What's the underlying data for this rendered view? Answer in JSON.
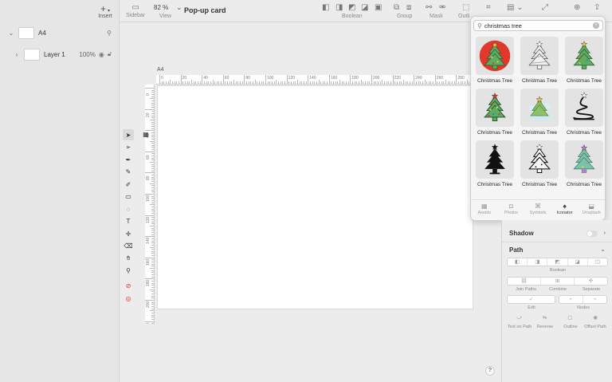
{
  "toolbar": {
    "insert_label": "Insert",
    "sidebar_label": "Sidebar",
    "view_label": "View",
    "zoom_value": "82 %",
    "document_title": "Pop-up card",
    "boolean_label": "Boolean",
    "group_label": "Group",
    "mask_label": "Mask",
    "outline_label": "Outli"
  },
  "layers": {
    "page_name": "A4",
    "layer_name": "Layer 1",
    "layer_opacity": "100%"
  },
  "canvas": {
    "artboard_label": "A4",
    "ruler_top": [
      "0",
      "20",
      "40",
      "60",
      "80",
      "100",
      "120",
      "140",
      "160",
      "180",
      "200",
      "220",
      "240",
      "260",
      "280"
    ],
    "ruler_left": [
      "0",
      "20",
      "40",
      "60",
      "80",
      "100",
      "120",
      "140",
      "160",
      "180",
      "200",
      "210"
    ]
  },
  "icon_search": {
    "query": "christmas tree",
    "results": [
      {
        "label": "Christmas Tree",
        "icon": "tree-red-circle-icon"
      },
      {
        "label": "Christmas Tree",
        "icon": "tree-outline-grey-icon"
      },
      {
        "label": "Christmas Tree",
        "icon": "tree-green-star-icon"
      },
      {
        "label": "Christmas Tree",
        "icon": "tree-decorated-icon"
      },
      {
        "label": "Christmas Tree",
        "icon": "tree-snow-icon"
      },
      {
        "label": "Christmas Tree",
        "icon": "tree-swirl-icon"
      },
      {
        "label": "Christmas Tree",
        "icon": "tree-black-icon"
      },
      {
        "label": "Christmas Tree",
        "icon": "tree-line-icon"
      },
      {
        "label": "Christmas Tree",
        "icon": "tree-teal-purple-icon"
      }
    ],
    "tabs": [
      "Assets",
      "Photos",
      "Symbols",
      "Iconator",
      "Unsplash"
    ],
    "active_tab": "Iconator"
  },
  "inspector": {
    "shadow_label": "Shadow",
    "path_label": "Path",
    "boolean_caption": "Boolean",
    "join_paths": "Join Paths",
    "combine": "Combine",
    "separate": "Separate",
    "edit": "Edit",
    "nodes": "Nodes",
    "text_on_path": "Text on Path",
    "reverse": "Reverse",
    "outline": "Outline",
    "offset_path": "Offset Path"
  },
  "help_label": "?",
  "colors": {
    "panel_bg": "#e6e6e6",
    "canvas_bg": "#ececec",
    "tree_green": "#5cae62",
    "red_accent": "#e0382c"
  }
}
